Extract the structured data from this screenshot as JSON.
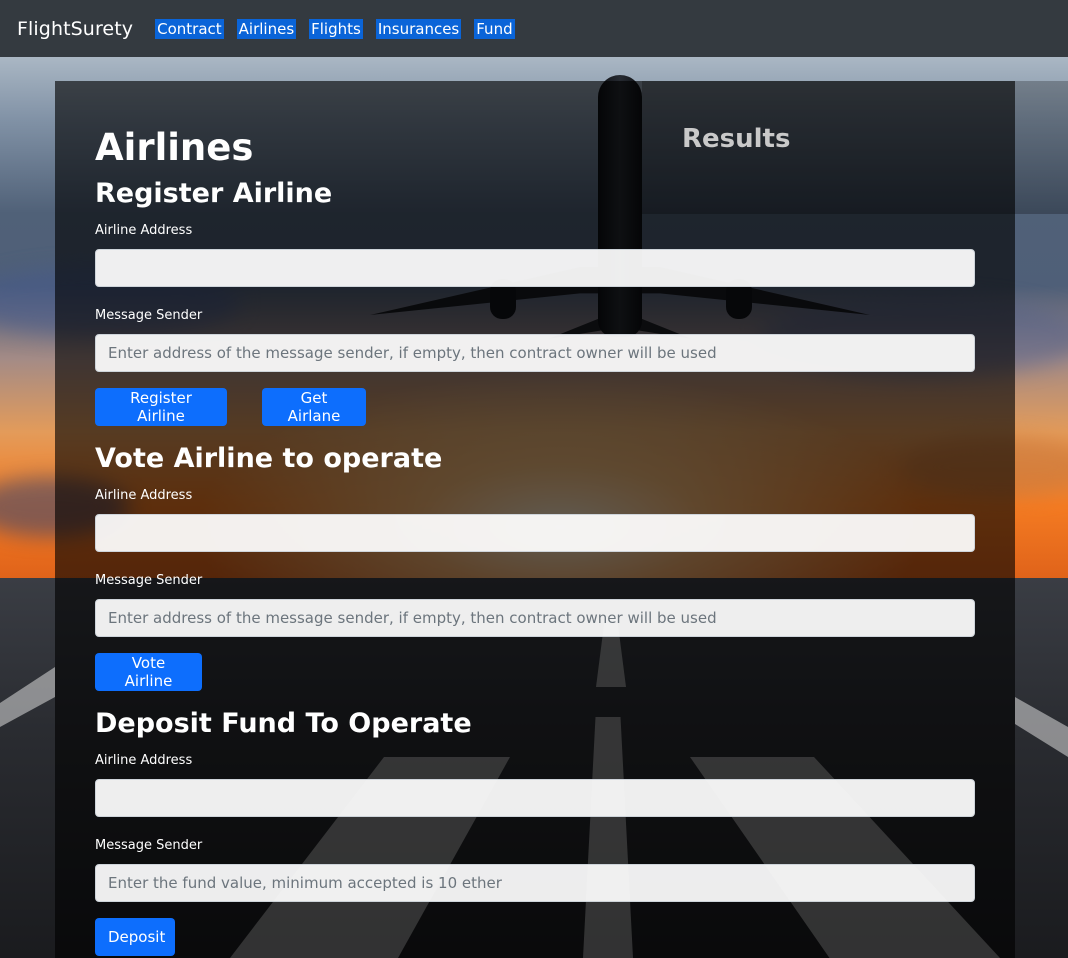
{
  "navbar": {
    "brand": "FlightSurety",
    "links": [
      "Contract",
      "Airlines",
      "Flights",
      "Insurances",
      "Fund"
    ]
  },
  "page": {
    "title": "Airlines",
    "results_title": "Results"
  },
  "register": {
    "title": "Register Airline",
    "address_label": "Airline Address",
    "address_value": "",
    "sender_label": "Message Sender",
    "sender_placeholder": "Enter address of the message sender, if empty, then contract owner will be used",
    "register_button": "Register Airline",
    "get_button": "Get Airlane"
  },
  "vote": {
    "title": "Vote Airline to operate",
    "address_label": "Airline Address",
    "address_value": "",
    "sender_label": "Message Sender",
    "sender_placeholder": "Enter address of the message sender, if empty, then contract owner will be used",
    "vote_button": "Vote Airline"
  },
  "deposit": {
    "title": "Deposit Fund To Operate",
    "address_label": "Airline Address",
    "address_value": "",
    "sender_label": "Message Sender",
    "sender_placeholder": "Enter the fund value, minimum accepted is 10 ether",
    "deposit_button": "Deposit"
  },
  "colors": {
    "navbar": "#343a40",
    "nav_link_highlight": "#0a64d8",
    "primary_button": "#0d6efd"
  }
}
